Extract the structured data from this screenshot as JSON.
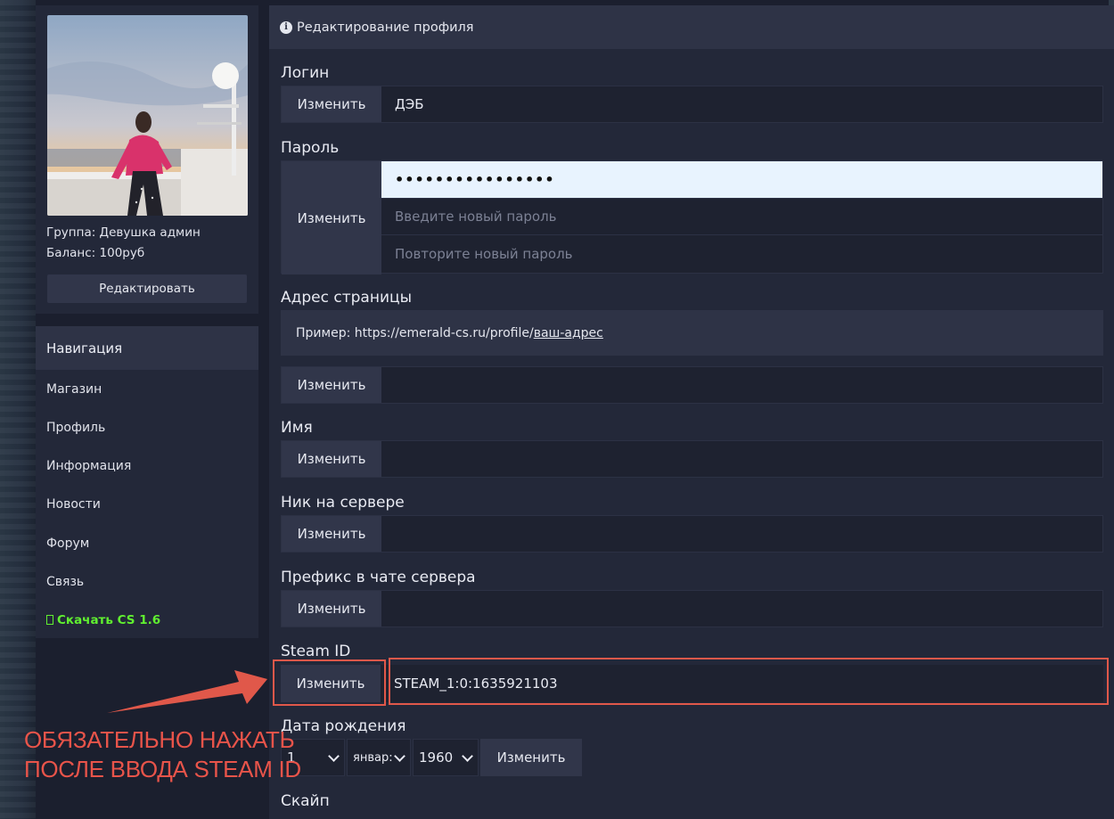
{
  "sidebar": {
    "group_text": "Группа: Девушка админ",
    "balance_text": "Баланс: 100руб",
    "edit_label": "Редактировать",
    "nav_title": "Навигация",
    "nav_items": [
      "Магазин",
      "Профиль",
      "Информация",
      "Новости",
      "Форум",
      "Связь"
    ],
    "download_icon": "\u0000",
    "download_label": "Скачать CS 1.6"
  },
  "panel": {
    "title": "Редактирование профиля",
    "info_icon": "i",
    "change_label": "Изменить",
    "login": {
      "label": "Логин",
      "value": "ДЭБ"
    },
    "password": {
      "label": "Пароль",
      "current_value": "••••••••••••••••",
      "new_placeholder": "Введите новый пароль",
      "repeat_placeholder": "Повторите новый пароль"
    },
    "page_address": {
      "label": "Адрес страницы",
      "example_prefix": "Пример: https://emerald-cs.ru/profile/",
      "example_link": "ваш-адрес"
    },
    "name": {
      "label": "Имя"
    },
    "server_nick": {
      "label": "Ник на сервере"
    },
    "chat_prefix": {
      "label": "Префикс в чате сервера"
    },
    "steam_id": {
      "label": "Steam ID",
      "value": "STEAM_1:0:1635921103"
    },
    "birthdate": {
      "label": "Дата рождения",
      "day": "1",
      "month": "январ:",
      "year": "1960"
    },
    "skype": {
      "label": "Скайп"
    }
  },
  "annotation": {
    "line1": "ОБЯЗАТЕЛЬНО НАЖАТЬ",
    "line2": "ПОСЛЕ ВВОДА STEAM ID",
    "color": "#e8544a"
  },
  "colors": {
    "background": "#1b1f2e",
    "panel": "#232839",
    "header": "#2e3346",
    "button": "#31364a",
    "download_link": "#60f030"
  }
}
